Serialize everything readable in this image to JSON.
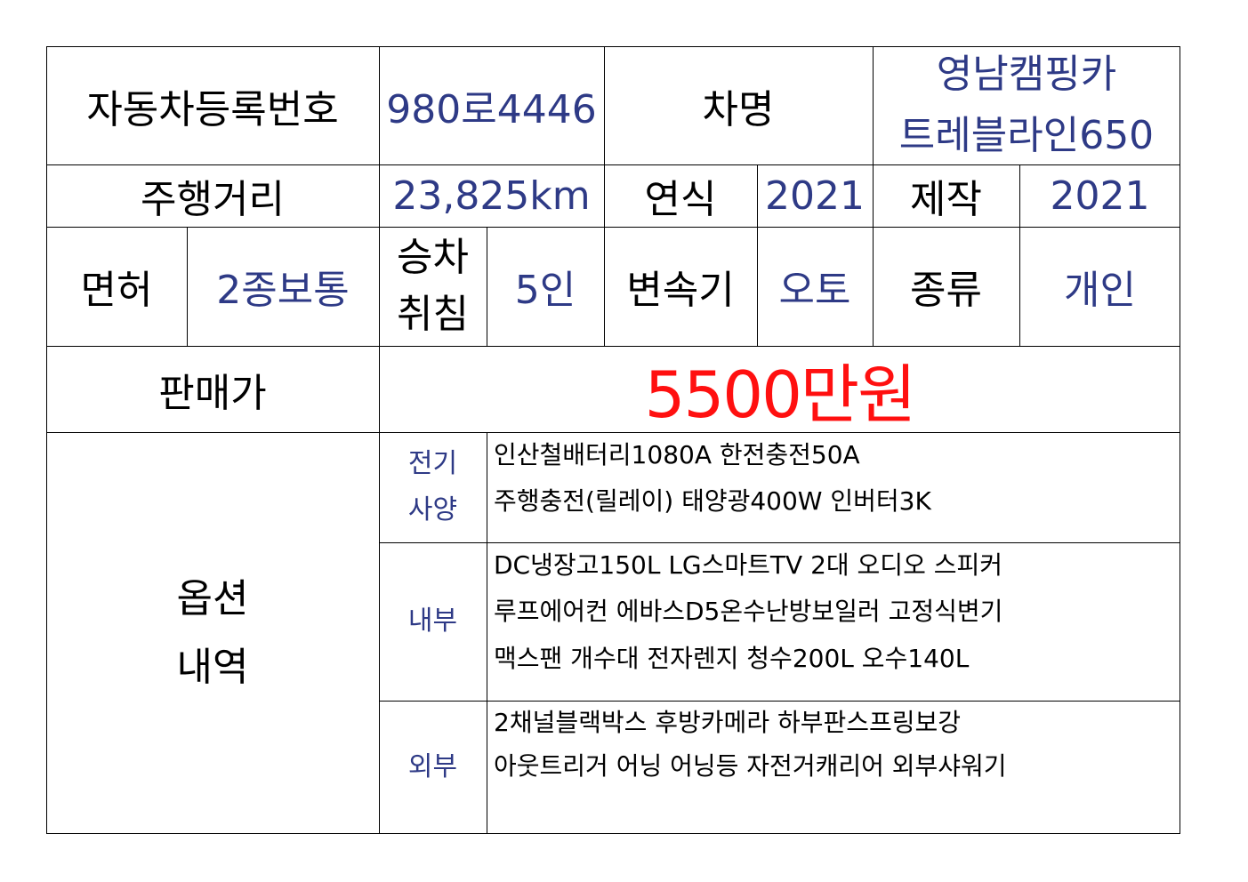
{
  "row1": {
    "reg_label": "자동차등록번호",
    "reg_value": "980로4446",
    "name_label": "차명",
    "name_value_line1": "영남캠핑카",
    "name_value_line2": "트레블라인650"
  },
  "row2": {
    "mileage_label": "주행거리",
    "mileage_value": "23,825km",
    "year_label": "연식",
    "year_value": "2021",
    "make_label": "제작",
    "make_value": "2021"
  },
  "row3": {
    "license_label": "면허",
    "license_value": "2종보통",
    "seat_label_line1": "승차",
    "seat_label_line2": "취침",
    "seat_value": "5인",
    "trans_label": "변속기",
    "trans_value": "오토",
    "type_label": "종류",
    "type_value": "개인"
  },
  "row4": {
    "price_label": "판매가",
    "price_value": "5500만원"
  },
  "options": {
    "label_line1": "옵션",
    "label_line2": "내역",
    "electric": {
      "label_line1": "전기",
      "label_line2": "사양",
      "lines": [
        "인산철배터리1080A 한전충전50A",
        "주행충전(릴레이) 태양광400W 인버터3K"
      ]
    },
    "interior": {
      "label": "내부",
      "lines": [
        "DC냉장고150L LG스마트TV 2대 오디오 스피커",
        "루프에어컨 에바스D5온수난방보일러 고정식변기",
        "맥스팬 개수대 전자렌지 청수200L 오수140L"
      ]
    },
    "exterior": {
      "label": "외부",
      "lines": [
        "2채널블랙박스 후방카메라 하부판스프링보강",
        "아웃트리거 어닝 어닝등 자전거캐리어 외부샤워기"
      ]
    }
  },
  "colors": {
    "value_text": "#2e3a86",
    "price_text": "#ff1010",
    "border": "#000000"
  }
}
